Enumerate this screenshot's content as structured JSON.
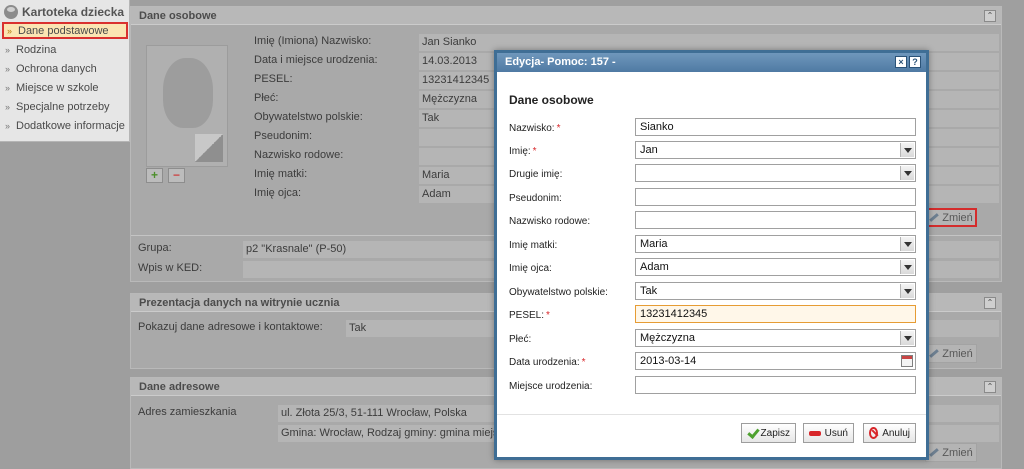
{
  "sidebar": {
    "title": "Kartoteka dziecka",
    "items": [
      {
        "label": "Dane podstawowe"
      },
      {
        "label": "Rodzina"
      },
      {
        "label": "Ochrona danych"
      },
      {
        "label": "Miejsce w szkole"
      },
      {
        "label": "Specjalne potrzeby"
      },
      {
        "label": "Dodatkowe informacje"
      }
    ],
    "bullet": "››"
  },
  "panels": {
    "dane_osobowe": {
      "title": "Dane osobowe",
      "fields": [
        {
          "label": "Imię (Imiona) Nazwisko:",
          "value": "Jan Sianko"
        },
        {
          "label": "Data i miejsce urodzenia:",
          "value": "14.03.2013"
        },
        {
          "label": "PESEL:",
          "value": "13231412345"
        },
        {
          "label": "Płeć:",
          "value": "Mężczyzna"
        },
        {
          "label": "Obywatelstwo polskie:",
          "value": "Tak"
        },
        {
          "label": "Pseudonim:",
          "value": ""
        },
        {
          "label": "Nazwisko rodowe:",
          "value": ""
        },
        {
          "label": "Imię matki:",
          "value": "Maria"
        },
        {
          "label": "Imię ojca:",
          "value": "Adam"
        }
      ],
      "grupa_label": "Grupa:",
      "grupa_value": "p2 \"Krasnale\" (P-50)",
      "ked_label": "Wpis w KED:",
      "ked_value": "",
      "change_label": "Zmień",
      "add_symbol": "+",
      "remove_symbol": "−"
    },
    "prezentacja": {
      "title": "Prezentacja danych na witrynie ucznia",
      "label": "Pokazuj dane adresowe i kontaktowe:",
      "value": "Tak",
      "change_label": "Zmień"
    },
    "adresowe": {
      "title": "Dane adresowe",
      "label": "Adres zamieszkania",
      "line1": "ul. Złota 25/3, 51-111 Wrocław, Polska",
      "line2": "Gmina: Wrocław, Rodzaj gminy: gmina miejsk",
      "change_label": "Zmień"
    },
    "collapse_symbol": "⌃"
  },
  "modal": {
    "title": "Edycja- Pomoc: 157 -",
    "close_symbol": "×",
    "help_symbol": "?",
    "section_title": "Dane osobowe",
    "required_mark": "*",
    "fields": {
      "nazwisko": {
        "label": "Nazwisko:",
        "value": "Sianko"
      },
      "imie": {
        "label": "Imię:",
        "value": "Jan"
      },
      "drugie_imie": {
        "label": "Drugie imię:",
        "value": ""
      },
      "pseudonim": {
        "label": "Pseudonim:",
        "value": ""
      },
      "nazwisko_rodowe": {
        "label": "Nazwisko rodowe:",
        "value": ""
      },
      "imie_matki": {
        "label": "Imię matki:",
        "value": "Maria"
      },
      "imie_ojca": {
        "label": "Imię ojca:",
        "value": "Adam"
      },
      "obywatelstwo": {
        "label": "Obywatelstwo polskie:",
        "value": "Tak"
      },
      "pesel": {
        "label": "PESEL:",
        "value": "13231412345"
      },
      "plec": {
        "label": "Płeć:",
        "value": "Mężczyzna"
      },
      "data_urodzenia": {
        "label": "Data urodzenia:",
        "value": "2013-03-14"
      },
      "miejsce_urodzenia": {
        "label": "Miejsce urodzenia:",
        "value": ""
      }
    },
    "buttons": {
      "save": "Zapisz",
      "delete": "Usuń",
      "cancel": "Anuluj"
    }
  },
  "colors": {
    "modal_titlebar": "#5a83ab",
    "required": "#d8262a",
    "highlight_border": "#d9312f",
    "active_item_bg": "#fbe5b3"
  }
}
